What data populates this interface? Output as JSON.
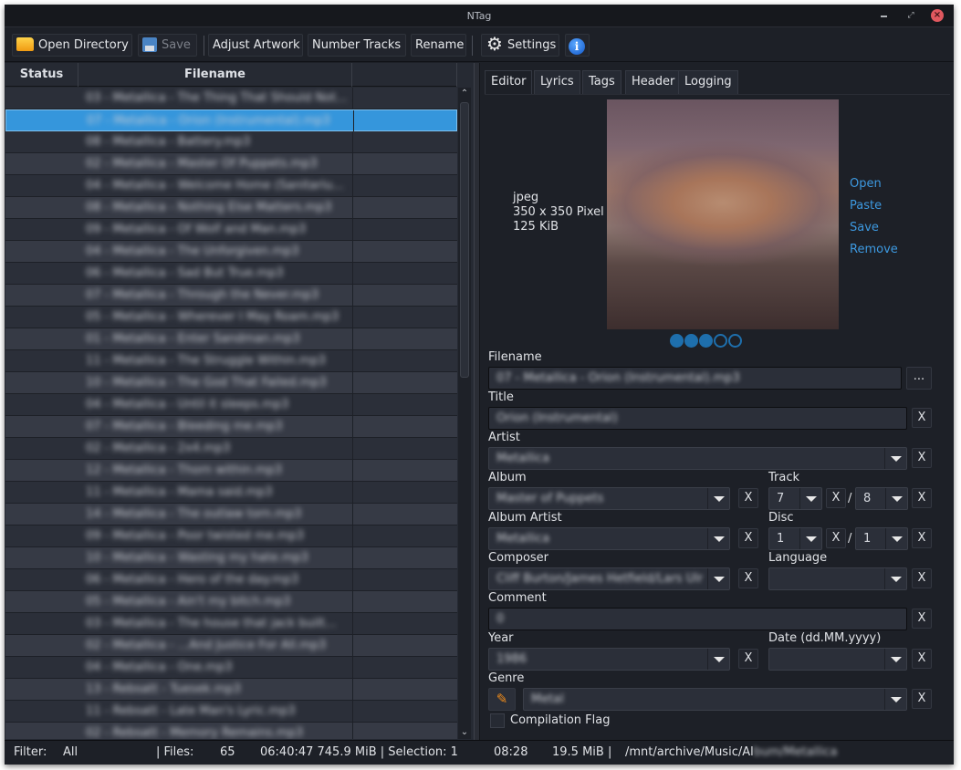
{
  "window": {
    "title": "NTag"
  },
  "toolbar": {
    "open_directory": "Open Directory",
    "save": "Save",
    "adjust_artwork": "Adjust Artwork",
    "number_tracks": "Number Tracks",
    "rename": "Rename",
    "settings": "Settings",
    "info_glyph": "i",
    "gear_glyph": "⚙"
  },
  "file_table": {
    "columns": [
      "Status",
      "Filename",
      ""
    ],
    "selected_index": 1,
    "rows": [
      "03 - Metallica - The Thing That Should Not...",
      "07 - Metallica - Orion (Instrumental).mp3",
      "08 - Metallica - Battery.mp3",
      "02 - Metallica - Master Of Puppets.mp3",
      "04 - Metallica - Welcome Home (Sanitariu...",
      "08 - Metallica - Nothing Else Matters.mp3",
      "09 - Metallica - Of Wolf and Man.mp3",
      "04 - Metallica - The Unforgiven.mp3",
      "06 - Metallica - Sad But True.mp3",
      "07 - Metallica - Through the Never.mp3",
      "05 - Metallica - Wherever I May Roam.mp3",
      "01 - Metallica - Enter Sandman.mp3",
      "11 - Metallica - The Struggle Within.mp3",
      "10 - Metallica - The God That Failed.mp3",
      "04 - Metallica - Until it sleeps.mp3",
      "07 - Metallica - Bleeding me.mp3",
      "02 - Metallica - 2x4.mp3",
      "12 - Metallica - Thorn within.mp3",
      "11 - Metallica - Mama said.mp3",
      "14 - Metallica - The outlaw torn.mp3",
      "09 - Metallica - Poor twisted me.mp3",
      "10 - Metallica - Wasting my hate.mp3",
      "06 - Metallica - Hero of the day.mp3",
      "05 - Metallica - Ain't my bitch.mp3",
      "03 - Metallica - The house that jack built...",
      "02 - Metallica - ...And Justice For All.mp3",
      "04 - Metallica - One.mp3",
      "13 - Rebsatt - Tuesek.mp3",
      "11 - Rebsatt - Late Man's Lyric.mp3",
      "02 - Rebsatt - Memory Remains.mp3"
    ]
  },
  "tabs": [
    "Editor",
    "Lyrics",
    "Tags",
    "Header",
    "Logging"
  ],
  "active_tab": "Editor",
  "artwork": {
    "format": "jpeg",
    "dimensions": "350 x 350 Pixel",
    "size": "125 KiB",
    "actions": [
      "Open",
      "Paste",
      "Save",
      "Remove"
    ],
    "pages_total": 5,
    "pages_filled": 3
  },
  "editor": {
    "filename_label": "Filename",
    "filename_value": "07 - Metallica - Orion (Instrumental).mp3",
    "browse_label": "...",
    "title_label": "Title",
    "title_value": "Orion (Instrumental)",
    "artist_label": "Artist",
    "artist_value": "Metallica",
    "album_label": "Album",
    "album_value": "Master of Puppets",
    "track_label": "Track",
    "track_value": "7",
    "track_total": "8",
    "album_artist_label": "Album Artist",
    "album_artist_value": "Metallica",
    "disc_label": "Disc",
    "disc_value": "1",
    "disc_total": "1",
    "composer_label": "Composer",
    "composer_value": "Cliff Burton/James Hetfield/Lars Ulr",
    "language_label": "Language",
    "language_value": "",
    "comment_label": "Comment",
    "comment_value": "0",
    "year_label": "Year",
    "year_value": "1986",
    "date_label": "Date (dd.MM.yyyy)",
    "date_value": "",
    "genre_label": "Genre",
    "genre_value": "Metal",
    "compilation_label": "Compilation Flag",
    "compilation_checked": false,
    "clear_label": "X",
    "slash": "/"
  },
  "statusbar": {
    "filter_label": "Filter:",
    "filter_value": "All",
    "files_label": "| Files:",
    "files_count": "65",
    "total": "06:40:47 745.9 MiB | Selection: 1",
    "selection_duration": "08:28",
    "selection_size": "19.5 MiB  |",
    "path": "/mnt/archive/Music/Album/Metallica"
  }
}
